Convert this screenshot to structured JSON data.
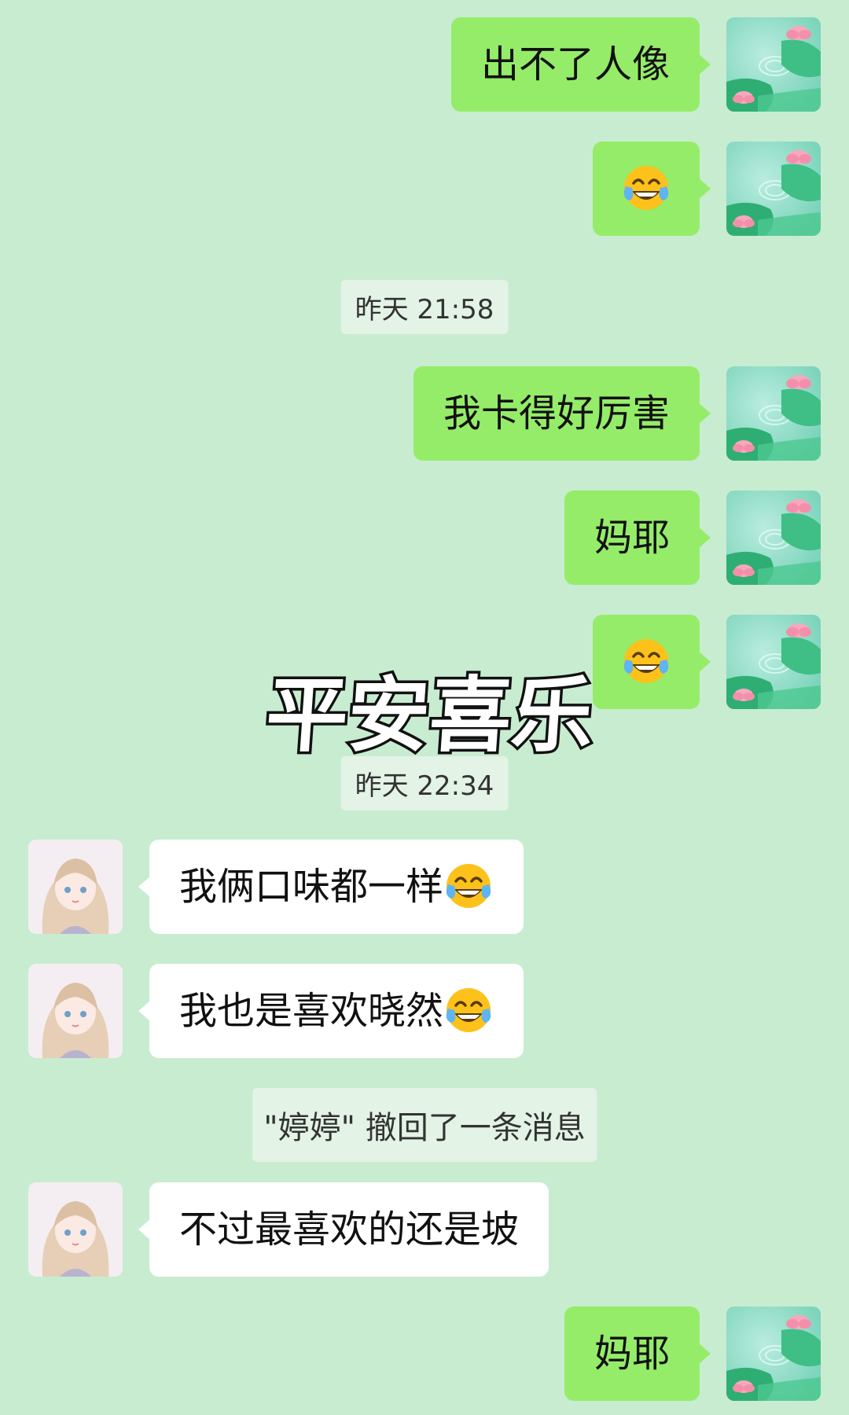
{
  "messages": [
    {
      "side": "me",
      "text": "出不了人像"
    },
    {
      "side": "me",
      "emoji": "tears-of-joy-emoji"
    },
    {
      "type": "time",
      "text": "昨天 21:58"
    },
    {
      "side": "me",
      "text": "我卡得好厉害"
    },
    {
      "side": "me",
      "text": "妈耶"
    },
    {
      "side": "me",
      "emoji": "tears-of-joy-emoji"
    },
    {
      "type": "time",
      "text": "昨天 22:34"
    },
    {
      "side": "other",
      "text": "我俩口味都一样",
      "emoji": "tears-of-joy-emoji"
    },
    {
      "side": "other",
      "text": "我也是喜欢晓然",
      "emoji": "tears-of-joy-emoji"
    },
    {
      "type": "system",
      "text": "\"婷婷\" 撤回了一条消息"
    },
    {
      "side": "other",
      "text": "不过最喜欢的还是坡"
    },
    {
      "side": "me",
      "text": "妈耶"
    }
  ],
  "overlay_sticker": {
    "text": "平安喜乐"
  },
  "colors": {
    "background": "#c8ecd0",
    "my_bubble": "#95ec69",
    "other_bubble": "#ffffff"
  }
}
